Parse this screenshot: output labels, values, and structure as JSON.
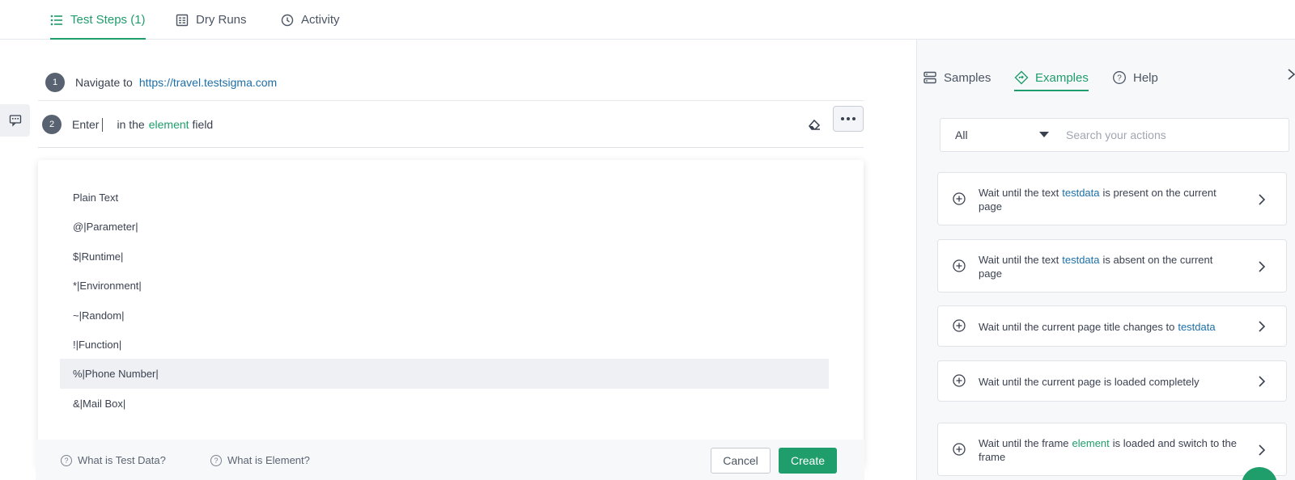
{
  "top_tabs": [
    {
      "label": "Test Steps (1)",
      "icon": "list-icon",
      "active": true
    },
    {
      "label": "Dry Runs",
      "icon": "report-icon",
      "active": false
    },
    {
      "label": "Activity",
      "icon": "clock-icon",
      "active": false
    }
  ],
  "steps": [
    {
      "number": "1",
      "action": "Navigate to",
      "url": "https://travel.testsigma.com"
    },
    {
      "number": "2",
      "prefix": "Enter",
      "middle": "in the",
      "element_word": "element",
      "suffix": "field"
    }
  ],
  "data_types": [
    "Plain Text",
    "@|Parameter|",
    "$|Runtime|",
    "*|Environment|",
    "~|Random|",
    "!|Function|",
    "%|Phone Number|",
    "&|Mail Box|"
  ],
  "highlighted_data_type": "%|Phone Number|",
  "footer": {
    "help_test_data": "What is Test Data?",
    "help_element": "What is Element?",
    "cancel": "Cancel",
    "create": "Create"
  },
  "right_tabs": [
    {
      "label": "Samples",
      "icon": "samples-icon",
      "active": false
    },
    {
      "label": "Examples",
      "icon": "examples-icon",
      "active": true
    },
    {
      "label": "Help",
      "icon": "help-icon",
      "active": false
    }
  ],
  "filter": {
    "selected": "All",
    "search_placeholder": "Search your actions"
  },
  "actions": [
    {
      "before": "Wait until the text",
      "token": "testdata",
      "token_type": "testdata",
      "after": "is present on the current page"
    },
    {
      "before": "Wait until the text",
      "token": "testdata",
      "token_type": "testdata",
      "after": "is absent on the current page"
    },
    {
      "before": "Wait until the current page title changes to",
      "token": "testdata",
      "token_type": "testdata",
      "after": ""
    },
    {
      "before": "Wait until the current page is loaded completely",
      "token": "",
      "token_type": "",
      "after": ""
    },
    {
      "before": "Wait until the frame",
      "token": "element",
      "token_type": "element",
      "after": "is loaded and switch to the frame"
    }
  ],
  "colors": {
    "accent": "#1f9d6b",
    "link": "#1d6fa8",
    "step_badge": "#596270"
  }
}
